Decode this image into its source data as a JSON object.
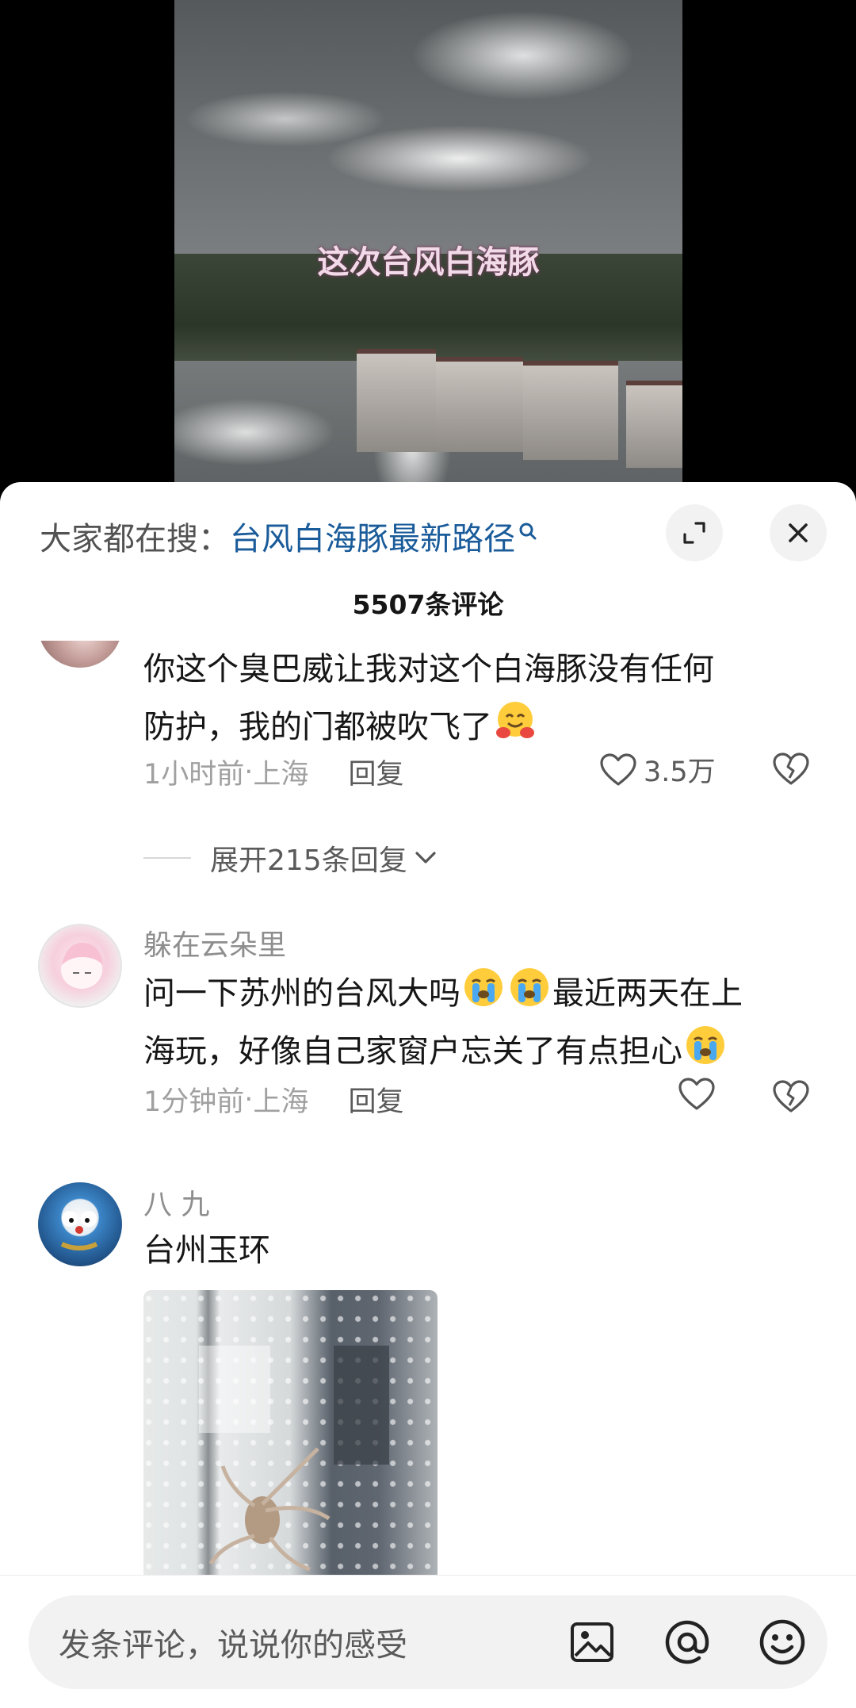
{
  "video": {
    "caption": "这次台风白海豚"
  },
  "search": {
    "prefix": "大家都在搜：",
    "term": "台风白海豚最新路径"
  },
  "comment_count": "5507条评论",
  "comments": [
    {
      "text_line1": "你这个臭巴威让我对这个白海豚没有任何",
      "text_line2": "防护，我的门都被吹飞了",
      "emoji": "hugging-face",
      "time": "1小时前",
      "location": "上海",
      "reply_label": "回复",
      "likes": "3.5万",
      "expand_label": "展开215条回复"
    },
    {
      "user": "躲在云朵里",
      "text_line1_a": "问一下苏州的台风大吗",
      "text_line1_b": "最近两天在上",
      "text_line2": "海玩，好像自己家窗户忘关了有点担心",
      "emoji": "loudly-crying-face",
      "time": "1分钟前",
      "location": "上海",
      "reply_label": "回复"
    },
    {
      "user": "八 九",
      "text": "台州玉环"
    }
  ],
  "meta_separator": " · ",
  "bottom_bar": {
    "placeholder": "发条评论，说说你的感受"
  },
  "colors": {
    "search_term": "#1a5b9a",
    "caption": "#f2dbe8",
    "background": "#ffffff"
  }
}
